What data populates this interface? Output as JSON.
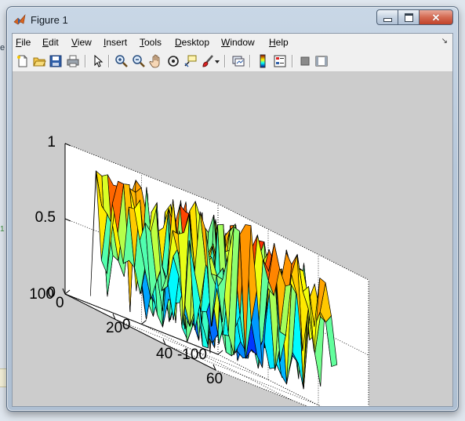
{
  "window": {
    "title": "Figure 1"
  },
  "menu": [
    {
      "key": "file",
      "label": "File",
      "u": "F",
      "rest": "ile"
    },
    {
      "key": "edit",
      "label": "Edit",
      "u": "E",
      "rest": "dit"
    },
    {
      "key": "view",
      "label": "View",
      "u": "V",
      "rest": "iew"
    },
    {
      "key": "insert",
      "label": "Insert",
      "u": "I",
      "rest": "nsert"
    },
    {
      "key": "tools",
      "label": "Tools",
      "u": "T",
      "rest": "ools"
    },
    {
      "key": "desktop",
      "label": "Desktop",
      "u": "D",
      "rest": "esktop"
    },
    {
      "key": "window",
      "label": "Window",
      "u": "W",
      "rest": "indow"
    },
    {
      "key": "help",
      "label": "Help",
      "u": "H",
      "rest": "elp"
    }
  ],
  "toolbar": {
    "buttons": [
      "new-figure-icon",
      "open-file-icon",
      "save-icon",
      "print-icon",
      "edit-plot-arrow-icon",
      "zoom-in-icon",
      "zoom-out-icon",
      "pan-hand-icon",
      "rotate-3d-icon",
      "data-cursor-icon",
      "brush-icon",
      "link-plot-icon",
      "colorbar-icon",
      "legend-icon",
      "hide-plot-tools-icon",
      "show-plot-tools-icon"
    ]
  },
  "colors": {
    "axes_background": "#cccccc",
    "surface_colormap": "jet",
    "edge_color": "#000000"
  },
  "chart_data": {
    "type": "surface-3d",
    "title": "",
    "z_ticks": [
      "0",
      "0.5",
      "1"
    ],
    "x_ticks": [
      "0",
      "20",
      "40",
      "60"
    ],
    "y_ticks": [
      "-100",
      "0",
      "100"
    ],
    "z_range": [
      0,
      1
    ],
    "x_range": [
      0,
      60
    ],
    "y_range": [
      -100,
      100
    ],
    "grid": true,
    "box": false,
    "surface_description": "random noise surface, values 0-1"
  },
  "background": {
    "left_letter": "e",
    "left_mark": "1"
  }
}
